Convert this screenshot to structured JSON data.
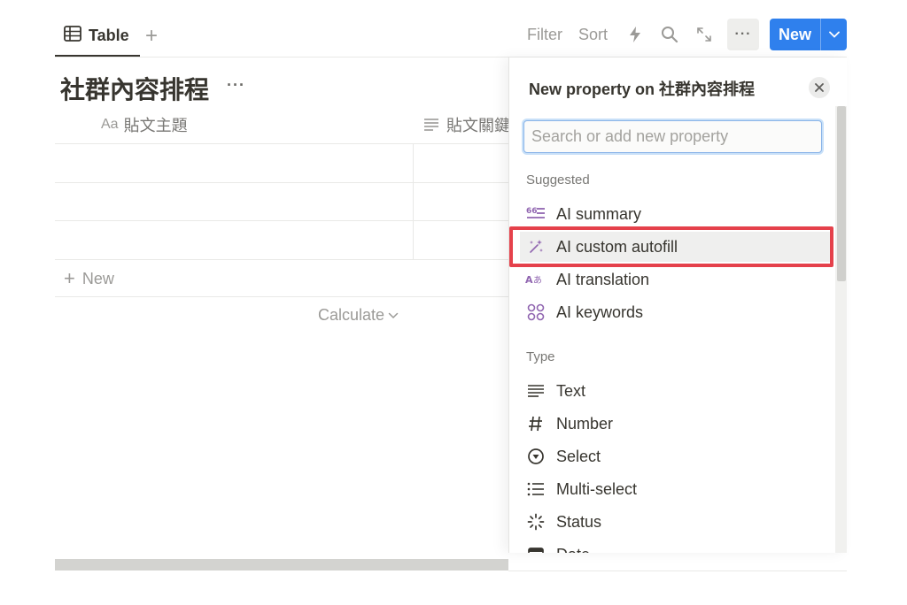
{
  "toolbar": {
    "tab_label": "Table",
    "add_tab": "+",
    "filter_label": "Filter",
    "sort_label": "Sort",
    "new_label": "New"
  },
  "table": {
    "title": "社群內容排程",
    "columns": [
      {
        "icon": "Aa",
        "label": "貼文主題"
      },
      {
        "icon": "text-lines-icon",
        "label": "貼文關鍵"
      }
    ],
    "rows": [
      [
        "",
        ""
      ],
      [
        "",
        ""
      ],
      [
        "",
        ""
      ]
    ],
    "add_row_label": "New",
    "calculate_label": "Calculate"
  },
  "panel": {
    "title": "New property on 社群內容排程",
    "search_placeholder": "Search or add new property",
    "suggested_heading": "Suggested",
    "suggested": [
      {
        "icon": "ai-summary-icon",
        "label": "AI summary"
      },
      {
        "icon": "sparkle-wand-icon",
        "label": "AI custom autofill"
      },
      {
        "icon": "ai-translation-icon",
        "label": "AI translation"
      },
      {
        "icon": "ai-keywords-icon",
        "label": "AI keywords"
      }
    ],
    "type_heading": "Type",
    "types": [
      {
        "icon": "text-lines-icon",
        "label": "Text"
      },
      {
        "icon": "hash-icon",
        "label": "Number"
      },
      {
        "icon": "select-circle-icon",
        "label": "Select"
      },
      {
        "icon": "list-icon",
        "label": "Multi-select"
      },
      {
        "icon": "status-spinner-icon",
        "label": "Status"
      },
      {
        "icon": "calendar-icon",
        "label": "Date"
      }
    ],
    "highlight_color": "#e5414b",
    "ai_icon_color": "#9065b0"
  }
}
